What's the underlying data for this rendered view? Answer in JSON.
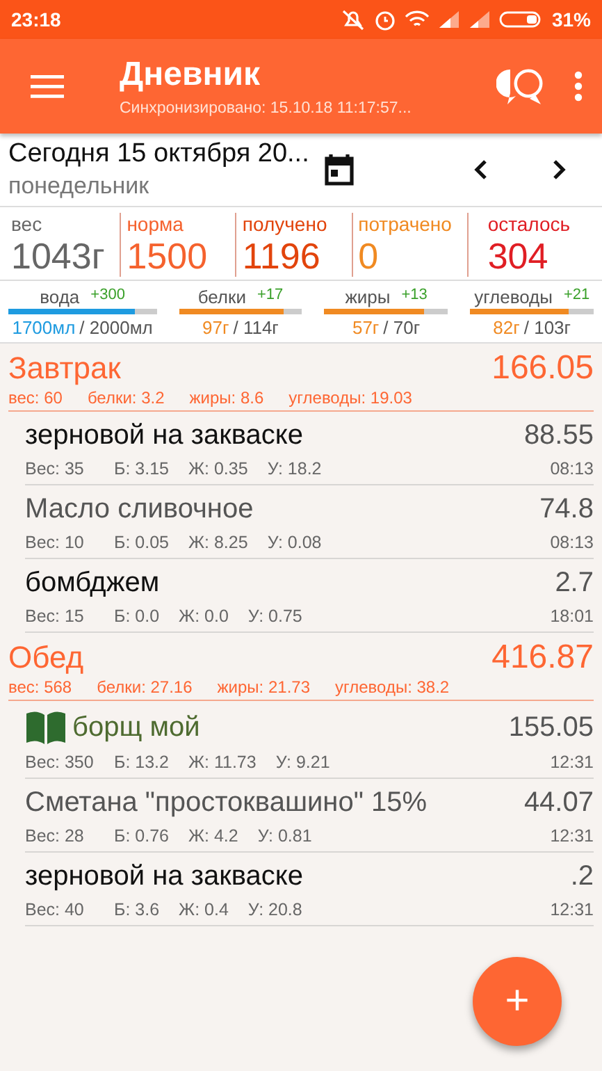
{
  "status_bar": {
    "time": "23:18",
    "battery": "31%"
  },
  "app_bar": {
    "title": "Дневник",
    "subtitle": "Синхронизировано: 15.10.18 11:17:57..."
  },
  "date_header": {
    "date": "Сегодня 15 октября 20...",
    "weekday": "понедельник"
  },
  "stats": [
    {
      "label": "вес",
      "value": "1043г",
      "color": "#666666"
    },
    {
      "label": "норма",
      "value": "1500",
      "color": "#f5622e"
    },
    {
      "label": "получено",
      "value": "1196",
      "color": "#e2440c"
    },
    {
      "label": "потрачено",
      "value": "0",
      "color": "#f08a22"
    },
    {
      "label": "осталось",
      "value": "304",
      "color": "#e01e24"
    }
  ],
  "macros": [
    {
      "label": "вода",
      "delta": "+300",
      "current": "1700мл",
      "total": "/ 2000мл",
      "level": 0.85,
      "color": "#1e9be0"
    },
    {
      "label": "белки",
      "delta": "+17",
      "current": "97г",
      "total": "/ 114г",
      "level": 0.85,
      "color": "#f08a22"
    },
    {
      "label": "жиры",
      "delta": "+13",
      "current": "57г",
      "total": "/ 70г",
      "level": 0.81,
      "color": "#f08a22"
    },
    {
      "label": "углеводы",
      "delta": "+21",
      "current": "82г",
      "total": "/ 103г",
      "level": 0.8,
      "color": "#f08a22"
    }
  ],
  "meals": [
    {
      "title": "Завтрак",
      "total": "166.05",
      "summary": [
        "вес: 60",
        "белки: 3.2",
        "жиры: 8.6",
        "углеводы: 19.03"
      ],
      "items": [
        {
          "name": "зерновой на закваске",
          "kind": "custom",
          "value": "88.55",
          "details": [
            "Вес: 35",
            "Б: 3.15",
            "Ж: 0.35",
            "У: 18.2"
          ],
          "time": "08:13"
        },
        {
          "name": "Масло сливочное",
          "kind": "product",
          "value": "74.8",
          "details": [
            "Вес: 10",
            "Б: 0.05",
            "Ж: 8.25",
            "У: 0.08"
          ],
          "time": "08:13"
        },
        {
          "name": "бомбджем",
          "kind": "custom",
          "value": "2.7",
          "details": [
            "Вес: 15",
            "Б: 0.0",
            "Ж: 0.0",
            "У: 0.75"
          ],
          "time": "18:01"
        }
      ]
    },
    {
      "title": "Обед",
      "total": "416.87",
      "summary": [
        "вес: 568",
        "белки: 27.16",
        "жиры: 21.73",
        "углеводы: 38.2"
      ],
      "items": [
        {
          "name": "борщ мой",
          "kind": "recipe",
          "value": "155.05",
          "details": [
            "Вес: 350",
            "Б: 13.2",
            "Ж: 11.73",
            "У: 9.21"
          ],
          "time": "12:31"
        },
        {
          "name": "Сметана \"простоквашино\" 15%",
          "kind": "product",
          "value": "44.07",
          "details": [
            "Вес: 28",
            "Б: 0.76",
            "Ж: 4.2",
            "У: 0.81"
          ],
          "time": "12:31"
        },
        {
          "name": "зерновой на закваске",
          "kind": "custom",
          "value": ".2",
          "details": [
            "Вес: 40",
            "Б: 3.6",
            "Ж: 0.4",
            "У: 20.8"
          ],
          "time": "12:31"
        }
      ]
    }
  ],
  "fab": {
    "label": "+"
  }
}
